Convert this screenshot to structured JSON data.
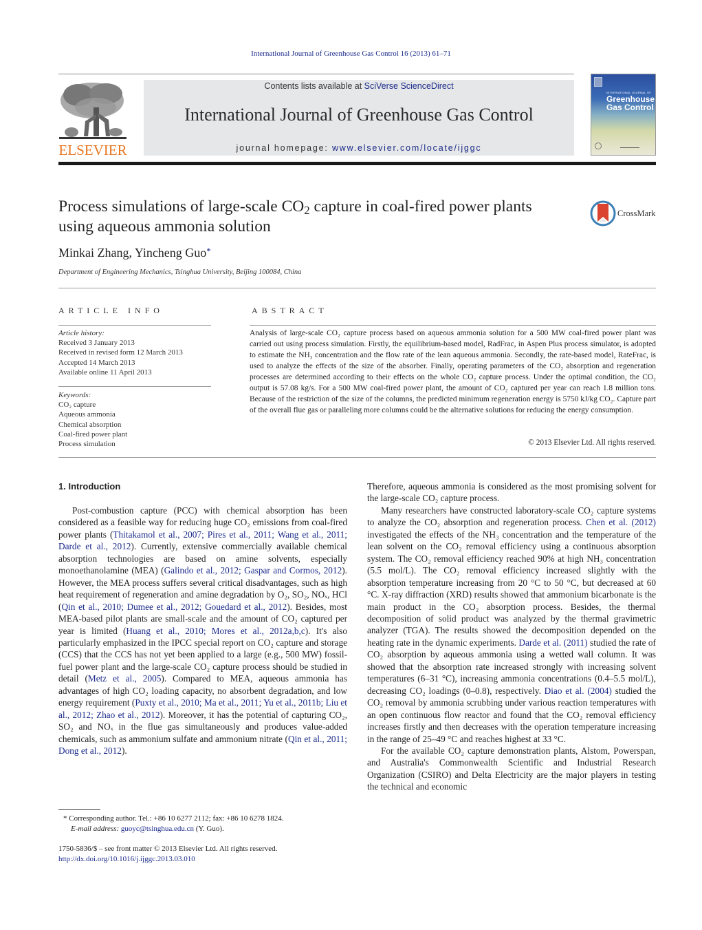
{
  "header": {
    "journal_citation": "International Journal of Greenhouse Gas Control 16 (2013) 61–71",
    "contents_prefix": "Contents lists available at ",
    "contents_link": "SciVerse ScienceDirect",
    "journal_title": "International Journal of Greenhouse Gas Control",
    "homepage_prefix": "journal homepage: ",
    "homepage_link": "www.elsevier.com/locate/ijggc",
    "publisher_logo_text": "ELSEVIER",
    "cover": {
      "subtitle": "INTERNATIONAL JOURNAL OF",
      "title_line1": "Greenhouse",
      "title_line2": "Gas Control"
    },
    "brand_color": "#e87722",
    "link_color": "#1a2a8a"
  },
  "article": {
    "title_part1": "Process simulations of large-scale CO",
    "title_sub": "2",
    "title_part2": " capture in coal-fired power plants using aqueous ammonia solution",
    "crossmark_label": "CrossMark",
    "authors": "Minkai Zhang, Yincheng Guo",
    "corresponding_mark": "*",
    "affiliation": "Department of Engineering Mechanics, Tsinghua University, Beijing 100084, China"
  },
  "article_info": {
    "heading": "ARTICLE INFO",
    "history_label": "Article history:",
    "history": [
      "Received 3 January 2013",
      "Received in revised form 12 March 2013",
      "Accepted 14 March 2013",
      "Available online 11 April 2013"
    ],
    "keywords_label": "Keywords:",
    "keywords": [
      "CO₂ capture",
      "Aqueous ammonia",
      "Chemical absorption",
      "Coal-fired power plant",
      "Process simulation"
    ]
  },
  "abstract": {
    "heading": "ABSTRACT",
    "text": "Analysis of large-scale CO₂ capture process based on aqueous ammonia solution for a 500 MW coal-fired power plant was carried out using process simulation. Firstly, the equilibrium-based model, RadFrac, in Aspen Plus process simulator, is adopted to estimate the NH₃ concentration and the flow rate of the lean aqueous ammonia. Secondly, the rate-based model, RateFrac, is used to analyze the effects of the size of the absorber. Finally, operating parameters of the CO₂ absorption and regeneration processes are determined according to their effects on the whole CO₂ capture process. Under the optimal condition, the CO₂ output is 57.08 kg/s. For a 500 MW coal-fired power plant, the amount of CO₂ captured per year can reach 1.8 million tons. Because of the restriction of the size of the columns, the predicted minimum regeneration energy is 5750 kJ/kg CO₂. Capture part of the overall flue gas or paralleling more columns could be the alternative solutions for reducing the energy consumption.",
    "copyright": "© 2013 Elsevier Ltd. All rights reserved."
  },
  "body": {
    "section_heading": "1.  Introduction",
    "left_column": [
      {
        "t": "Post-combustion capture (PCC) with chemical absorption has been considered as a feasible way for reducing huge CO₂ emissions from coal-fired power plants ("
      },
      {
        "link": "Thitakamol et al., 2007; Pires et al., 2011; Wang et al., 2011; Darde et al., 2012"
      },
      {
        "t": "). Currently, extensive commercially available chemical absorption technologies are based on amine solvents, especially monoethanolamine (MEA) ("
      },
      {
        "link": "Galindo et al., 2012; Gaspar and Cormos, 2012"
      },
      {
        "t": "). However, the MEA process suffers several critical disadvantages, such as high heat requirement of regeneration and amine degradation by O₂, SO₂, NOₓ, HCl ("
      },
      {
        "link": "Qin et al., 2010; Dumee et al., 2012; Gouedard et al., 2012"
      },
      {
        "t": "). Besides, most MEA-based pilot plants are small-scale and the amount of CO₂ captured per year is limited ("
      },
      {
        "link": "Huang et al., 2010; Mores et al., 2012a,b,c"
      },
      {
        "t": "). It's also particularly emphasized in the IPCC special report on CO₂ capture and storage (CCS) that the CCS has not yet been applied to a large (e.g., 500 MW) fossil-fuel power plant and the large-scale CO₂ capture process should be studied in detail ("
      },
      {
        "link": "Metz et al., 2005"
      },
      {
        "t": "). Compared to MEA, aqueous ammonia has advantages of high CO₂ loading capacity, no absorbent degradation, and low energy requirement ("
      },
      {
        "link": "Puxty et al., 2010; Ma et al., 2011; Yu et al., 2011b; Liu et al., 2012; Zhao et al., 2012"
      },
      {
        "t": "). Moreover, it has the potential of capturing CO₂, SO₂ and NOₓ in the flue gas simultaneously and produces value-added chemicals, such as ammonium sulfate and ammonium nitrate ("
      },
      {
        "link": "Qin et al., 2011; Dong et al., 2012"
      },
      {
        "t": ")."
      }
    ],
    "right_column": {
      "p1": "Therefore, aqueous ammonia is considered as the most promising solvent for the large-scale CO₂ capture process.",
      "p2": [
        {
          "t": "Many researchers have constructed laboratory-scale CO₂ capture systems to analyze the CO₂ absorption and regeneration process. "
        },
        {
          "link": "Chen et al. (2012)"
        },
        {
          "t": " investigated the effects of the NH₃ concentration and the temperature of the lean solvent on the CO₂ removal efficiency using a continuous absorption system. The CO₂ removal efficiency reached 90% at high NH₃ concentration (5.5 mol/L). The CO₂ removal efficiency increased slightly with the absorption temperature increasing from 20 °C to 50 °C, but decreased at 60 °C. X-ray diffraction (XRD) results showed that ammonium bicarbonate is the main product in the CO₂ absorption process. Besides, the thermal decomposition of solid product was analyzed by the thermal gravimetric analyzer (TGA). The results showed the decomposition depended on the heating rate in the dynamic experiments. "
        },
        {
          "link": "Darde et al. (2011)"
        },
        {
          "t": " studied the rate of CO₂ absorption by aqueous ammonia using a wetted wall column. It was showed that the absorption rate increased strongly with increasing solvent temperatures (6–31 °C), increasing ammonia concentrations (0.4–5.5 mol/L), decreasing CO₂ loadings (0–0.8), respectively. "
        },
        {
          "link": "Diao et al. (2004)"
        },
        {
          "t": " studied the CO₂ removal by ammonia scrubbing under various reaction temperatures with an open continuous flow reactor and found that the CO₂ removal efficiency increases firstly and then decreases with the operation temperature increasing in the range of 25–49 °C and reaches highest at 33 °C."
        }
      ],
      "p3": "For the available CO₂ capture demonstration plants, Alstom, Powerspan, and Australia's Commonwealth Scientific and Industrial Research Organization (CSIRO) and Delta Electricity are the major players in testing the technical and economic"
    }
  },
  "footnote": {
    "mark": "*",
    "text": "Corresponding author. Tel.: +86 10 6277 2112; fax: +86 10 6278 1824.",
    "email_label": "E-mail address:",
    "email": "guoyc@tsinghua.edu.cn",
    "email_suffix": " (Y. Guo)."
  },
  "front_matter": {
    "issn_line": "1750-5836/$ – see front matter © 2013 Elsevier Ltd. All rights reserved.",
    "doi_link": "http://dx.doi.org/10.1016/j.ijggc.2013.03.010"
  }
}
